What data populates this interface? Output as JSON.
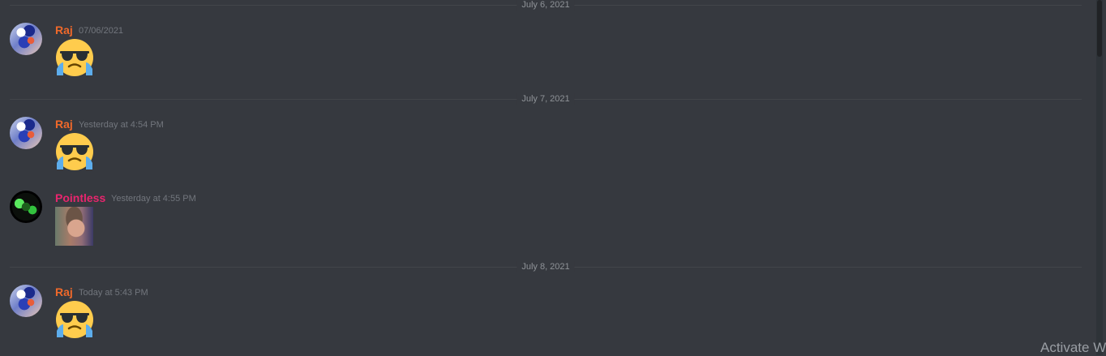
{
  "dividers": [
    {
      "label": "July 6, 2021"
    },
    {
      "label": "July 7, 2021"
    },
    {
      "label": "July 8, 2021"
    }
  ],
  "messages": [
    {
      "author": "Raj",
      "timestamp": "07/06/2021",
      "content": "sunglasses-crying-emoji",
      "author_color": "#f0692a"
    },
    {
      "author": "Raj",
      "timestamp": "Yesterday at 4:54 PM",
      "content": "sunglasses-crying-emoji",
      "author_color": "#f0692a"
    },
    {
      "author": "Pointless",
      "timestamp": "Yesterday at 4:55 PM",
      "content": "image-attachment",
      "author_color": "#e9256e"
    },
    {
      "author": "Raj",
      "timestamp": "Today at 5:43 PM",
      "content": "sunglasses-crying-emoji",
      "author_color": "#f0692a"
    }
  ],
  "watermark": {
    "text": "Activate W"
  }
}
